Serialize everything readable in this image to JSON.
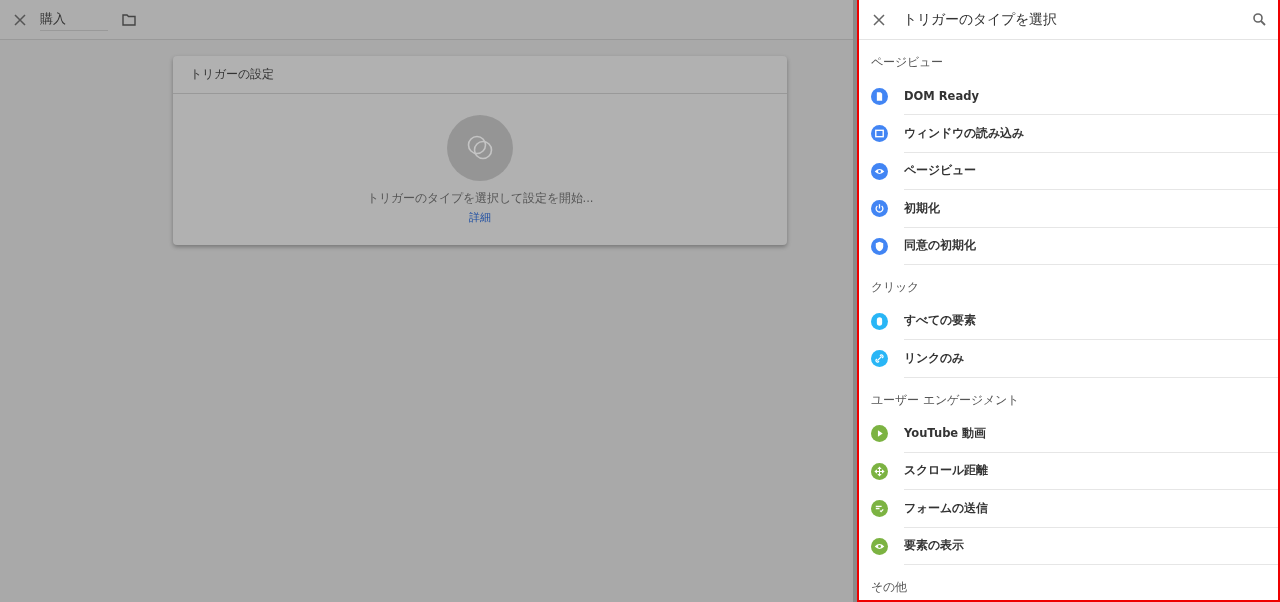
{
  "editor": {
    "name_field": {
      "value": "購入"
    },
    "card": {
      "title": "トリガーの設定",
      "prompt": "トリガーのタイプを選択して設定を開始...",
      "link": "詳細"
    }
  },
  "panel": {
    "title": "トリガーのタイプを選択",
    "sections": [
      {
        "title": "ページビュー",
        "items": [
          {
            "label": "DOM Ready",
            "kind": "document",
            "color": "#4285f4"
          },
          {
            "label": "ウィンドウの読み込み",
            "kind": "window",
            "color": "#4285f4"
          },
          {
            "label": "ページビュー",
            "kind": "eye",
            "color": "#4285f4"
          },
          {
            "label": "初期化",
            "kind": "power",
            "color": "#4285f4"
          },
          {
            "label": "同意の初期化",
            "kind": "shield",
            "color": "#4285f4"
          }
        ]
      },
      {
        "title": "クリック",
        "items": [
          {
            "label": "すべての要素",
            "kind": "mouse",
            "color": "#29b6f6"
          },
          {
            "label": "リンクのみ",
            "kind": "link",
            "color": "#29b6f6"
          }
        ]
      },
      {
        "title": "ユーザー エンゲージメント",
        "items": [
          {
            "label": "YouTube 動画",
            "kind": "play",
            "color": "#7cb342"
          },
          {
            "label": "スクロール距離",
            "kind": "move",
            "color": "#7cb342"
          },
          {
            "label": "フォームの送信",
            "kind": "form",
            "color": "#7cb342"
          },
          {
            "label": "要素の表示",
            "kind": "eye",
            "color": "#7cb342"
          }
        ]
      },
      {
        "title": "その他"
      }
    ]
  }
}
